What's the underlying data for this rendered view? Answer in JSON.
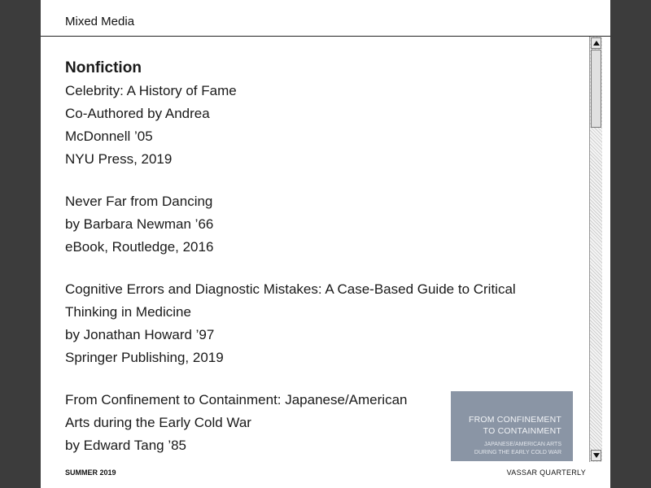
{
  "header": {
    "title": "Mixed Media"
  },
  "section": {
    "heading": "Nonfiction"
  },
  "entries": [
    {
      "lines": [
        "Celebrity: A History of Fame",
        "Co-Authored by Andrea",
        "McDonnell ’05",
        "NYU Press, 2019"
      ]
    },
    {
      "lines": [
        "Never Far from Dancing",
        "by Barbara Newman ’66",
        "eBook, Routledge, 2016"
      ]
    },
    {
      "lines": [
        "Cognitive Errors and Diagnostic Mistakes: A Case-Based Guide to Critical",
        "Thinking in Medicine",
        "by Jonathan Howard ’97",
        "Springer Publishing, 2019"
      ]
    },
    {
      "lines": [
        "From Confinement to Containment: Japanese/American",
        "Arts during the Early Cold War",
        "by Edward Tang ’85"
      ],
      "cover": {
        "title_lines": [
          "FROM CONFINEMENT",
          "TO CONTAINMENT"
        ],
        "subtitle_lines": [
          "JAPANESE/AMERICAN ARTS",
          "DURING THE EARLY COLD WAR"
        ],
        "color": "#8a95a5"
      }
    }
  ],
  "footer": {
    "left": "SUMMER 2019",
    "right": "VASSAR QUARTERLY"
  },
  "scrollbar": {
    "up_icon": "arrow-up-icon",
    "down_icon": "arrow-down-icon"
  }
}
